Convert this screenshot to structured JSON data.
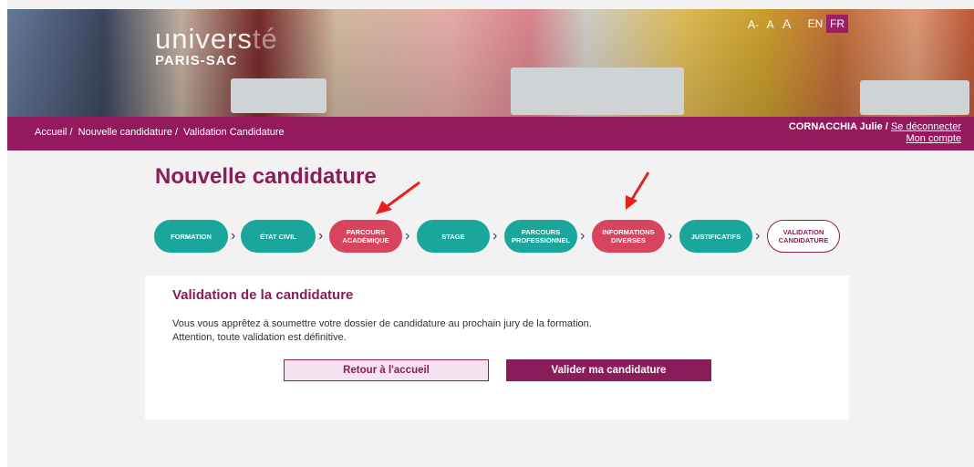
{
  "header": {
    "logo_line1": "univers",
    "logo_line1b": "té",
    "logo_line2": "PARIS-SAC",
    "font_controls": [
      "A-",
      "A",
      "A"
    ],
    "lang_en": "EN",
    "lang_fr": "FR"
  },
  "nav": {
    "breadcrumb": [
      "Accueil /",
      "Nouvelle candidature /",
      "Validation Candidature"
    ],
    "user_name": "CORNACCHIA Julie /",
    "logout": "Se déconnecter",
    "account": "Mon compte"
  },
  "page_title": "Nouvelle candidature",
  "steps": [
    {
      "label": "FORMATION",
      "state": "done"
    },
    {
      "label": "ÉTAT CIVIL",
      "state": "done"
    },
    {
      "label": "PARCOURS ACADÉMIQUE",
      "state": "error"
    },
    {
      "label": "STAGE",
      "state": "done"
    },
    {
      "label": "PARCOURS PROFESSIONNEL",
      "state": "done"
    },
    {
      "label": "INFORMATIONS DIVERSES",
      "state": "error"
    },
    {
      "label": "JUSTIFICATIFS",
      "state": "done"
    },
    {
      "label": "VALIDATION CANDIDATURE",
      "state": "current"
    }
  ],
  "card": {
    "heading": "Validation de la candidature",
    "line1": "Vous vous apprêtez à soumettre votre dossier de candidature au prochain jury de la formation.",
    "line2": "Attention, toute validation est définitive.",
    "back_button": "Retour à l'accueil",
    "validate_button": "Valider ma candidature"
  },
  "colors": {
    "brand": "#94195f",
    "teal": "#1aa69b",
    "error": "#d8445d"
  }
}
